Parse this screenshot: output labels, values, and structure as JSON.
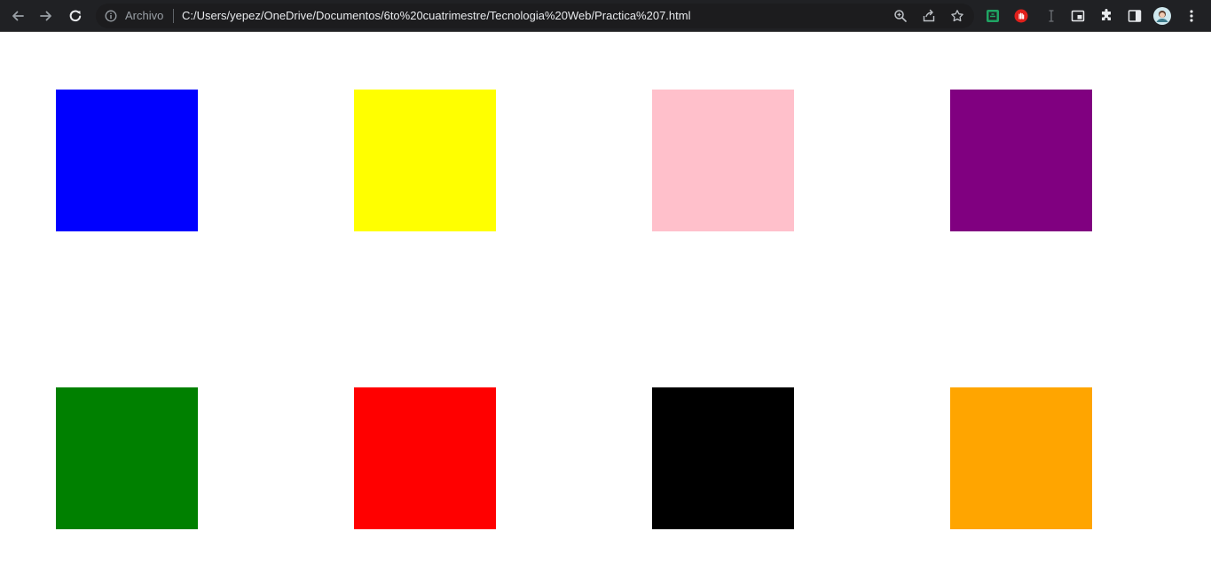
{
  "browser": {
    "scheme_label": "Archivo",
    "url": "C:/Users/yepez/OneDrive/Documentos/6to%20cuatrimestre/Tecnologia%20Web/Practica%207.html",
    "toolbar_icons": [
      "back-icon",
      "forward-icon",
      "reload-icon",
      "info-icon",
      "zoom-icon",
      "share-icon",
      "bookmark-star-icon",
      "extension-green-icon",
      "extension-red-hand-icon",
      "text-cursor-icon",
      "picture-in-picture-icon",
      "puzzle-icon",
      "side-panel-icon",
      "avatar",
      "menu-dots-icon"
    ]
  },
  "page": {
    "swatches": [
      {
        "name": "blue",
        "color": "#0000ff"
      },
      {
        "name": "yellow",
        "color": "#ffff00"
      },
      {
        "name": "pink",
        "color": "#ffc0cb"
      },
      {
        "name": "purple",
        "color": "#800080"
      },
      {
        "name": "green",
        "color": "#008000"
      },
      {
        "name": "red",
        "color": "#ff0000"
      },
      {
        "name": "black",
        "color": "#000000"
      },
      {
        "name": "orange",
        "color": "#ffa500"
      }
    ]
  }
}
